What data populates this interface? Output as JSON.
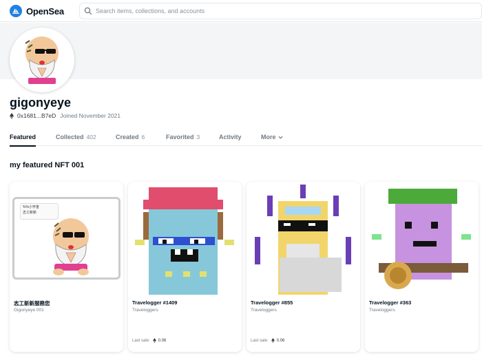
{
  "header": {
    "brand": "OpenSea",
    "search_placeholder": "Search items, collections, and accounts",
    "brand_color": "#2081e2"
  },
  "profile": {
    "username": "gigonyeye",
    "address": "0x1681...B7eD",
    "joined": "Joined November 2021"
  },
  "tabs": [
    {
      "label": "Featured",
      "count": "",
      "active": true
    },
    {
      "label": "Collected",
      "count": "402"
    },
    {
      "label": "Created",
      "count": "6"
    },
    {
      "label": "Favorited",
      "count": "3"
    },
    {
      "label": "Activity",
      "count": ""
    },
    {
      "label": "More",
      "count": ""
    }
  ],
  "featured": {
    "title": "my featured NFT 001",
    "cards": [
      {
        "title": "志工新新服務您",
        "subtitle": "Gigonyeye 001",
        "sale_label": "",
        "price": "",
        "badge_line1": "%%小宇宙",
        "badge_line2": "志工新新"
      },
      {
        "title": "Travelogger #1409",
        "subtitle": "Traveloggers",
        "sale_label": "Last sale:",
        "price": "0.06"
      },
      {
        "title": "Travelogger #855",
        "subtitle": "Traveloggers",
        "sale_label": "Last sale:",
        "price": "0.06"
      },
      {
        "title": "Travelogger #363",
        "subtitle": "Traveloggers",
        "sale_label": "",
        "price": ""
      }
    ]
  },
  "icons": {
    "logo": "opensea-logo-icon",
    "search": "search-icon",
    "eth": "ethereum-icon",
    "more": "chevron-down-icon"
  }
}
